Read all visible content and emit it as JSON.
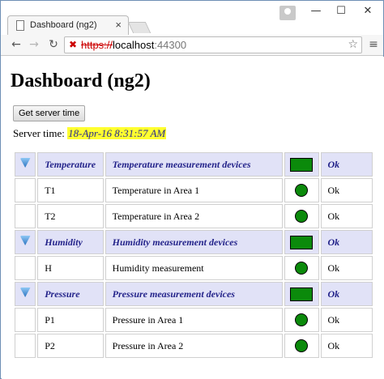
{
  "browser": {
    "tab_title": "Dashboard (ng2)",
    "url_scheme": "https://",
    "url_host": "localhost",
    "url_port": ":44300"
  },
  "page": {
    "title": "Dashboard (ng2)",
    "server_button_label": "Get server time",
    "server_time_label": "Server time:",
    "server_time_value": "18-Apr-16 8:31:57 AM"
  },
  "colors": {
    "status_ok": "#0b8a0b",
    "group_row_bg": "#e1e2f7",
    "group_text": "#23238a",
    "highlight": "#ffff30"
  },
  "groups": [
    {
      "name": "Temperature",
      "description": "Temperature measurement devices",
      "status": "Ok",
      "devices": [
        {
          "id": "T1",
          "description": "Temperature in Area 1",
          "status": "Ok"
        },
        {
          "id": "T2",
          "description": "Temperature in Area 2",
          "status": "Ok"
        }
      ]
    },
    {
      "name": "Humidity",
      "description": "Humidity measurement devices",
      "status": "Ok",
      "devices": [
        {
          "id": "H",
          "description": "Humidity measurement",
          "status": "Ok"
        }
      ]
    },
    {
      "name": "Pressure",
      "description": "Pressure measurement devices",
      "status": "Ok",
      "devices": [
        {
          "id": "P1",
          "description": "Pressure in Area 1",
          "status": "Ok"
        },
        {
          "id": "P2",
          "description": "Pressure in Area 2",
          "status": "Ok"
        }
      ]
    }
  ]
}
